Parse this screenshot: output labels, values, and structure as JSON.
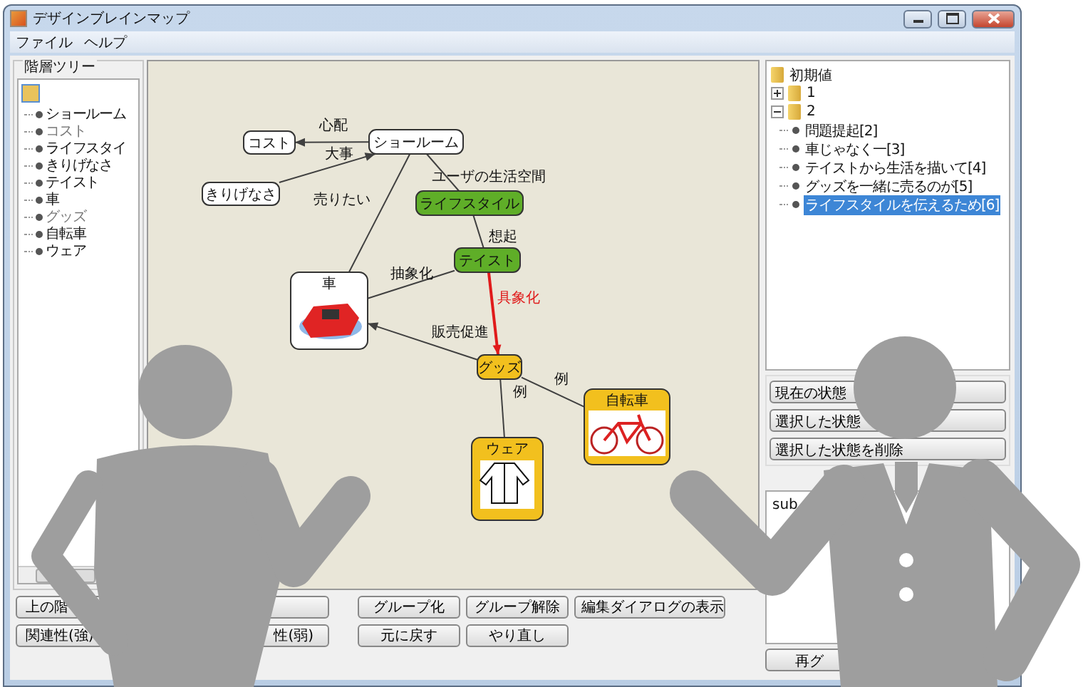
{
  "window": {
    "title": "デザインブレインマップ"
  },
  "menu": [
    "ファイル",
    "ヘルプ"
  ],
  "hierarchy_tree": {
    "title": "階層ツリー",
    "items": [
      {
        "label": "ショールーム",
        "dimmed": false
      },
      {
        "label": "コスト",
        "dimmed": true
      },
      {
        "label": "ライフスタイ",
        "dimmed": false
      },
      {
        "label": "きりげなさ",
        "dimmed": false
      },
      {
        "label": "テイスト",
        "dimmed": false
      },
      {
        "label": "車",
        "dimmed": false
      },
      {
        "label": "グッズ",
        "dimmed": true
      },
      {
        "label": "自転車",
        "dimmed": false
      },
      {
        "label": "ウェア",
        "dimmed": false
      }
    ]
  },
  "map": {
    "nodes": [
      {
        "label": "コスト",
        "kind": "text",
        "color": "#ffffff"
      },
      {
        "label": "ショールーム",
        "kind": "text",
        "color": "#ffffff"
      },
      {
        "label": "ライフスタイル",
        "kind": "text",
        "color": "#5fae28"
      },
      {
        "label": "きりげなさ",
        "kind": "text",
        "color": "#ffffff"
      },
      {
        "label": "テイスト",
        "kind": "text",
        "color": "#5fae28"
      },
      {
        "label": "車",
        "kind": "car",
        "color": "#ffffff"
      },
      {
        "label": "グッズ",
        "kind": "text",
        "color": "#f2c01e"
      },
      {
        "label": "自転車",
        "kind": "bicycle",
        "color": "#f2c01e"
      },
      {
        "label": "ウェア",
        "kind": "jacket",
        "color": "#f2c01e"
      }
    ],
    "edges": [
      {
        "label": "心配",
        "color": "#404040",
        "directed": true
      },
      {
        "label": "大事",
        "color": "#404040",
        "directed": true
      },
      {
        "label": "ユーザの生活空間",
        "color": "#404040",
        "directed": false
      },
      {
        "label": "売りたい",
        "color": "#404040",
        "directed": false
      },
      {
        "label": "想起",
        "color": "#404040",
        "directed": false
      },
      {
        "label": "抽象化",
        "color": "#404040",
        "directed": false
      },
      {
        "label": "具象化",
        "color": "#e01b1b",
        "directed": true
      },
      {
        "label": "販売促進",
        "color": "#404040",
        "directed": true
      },
      {
        "label": "例",
        "color": "#404040",
        "directed": false
      },
      {
        "label": "例",
        "color": "#404040",
        "directed": false
      }
    ]
  },
  "state_tree": {
    "root": "初期値",
    "children": [
      {
        "label": "1",
        "expanded": false
      },
      {
        "label": "2",
        "expanded": true,
        "children": [
          {
            "label": "問題提起[2]",
            "selected": false
          },
          {
            "label": "車じゃなく一[3]",
            "selected": false
          },
          {
            "label": "テイストから生活を描いて[4]",
            "selected": false
          },
          {
            "label": "グッズを一緒に売るのが[5]",
            "selected": false
          },
          {
            "label": "ライフスタイルを伝えるため[6]",
            "selected": true
          }
        ]
      }
    ]
  },
  "state_buttons": [
    "現在の状態",
    "選択した状態",
    "選択した状態を削除"
  ],
  "memo": {
    "value": "sub"
  },
  "side_button": "再グ",
  "bottom_buttons": [
    [
      "上の階",
      "グループ化",
      "グループ解除",
      "編集ダイアログの表示"
    ],
    [
      "関連性(強)",
      "性(弱)",
      "元に戻す",
      "やり直し"
    ]
  ]
}
